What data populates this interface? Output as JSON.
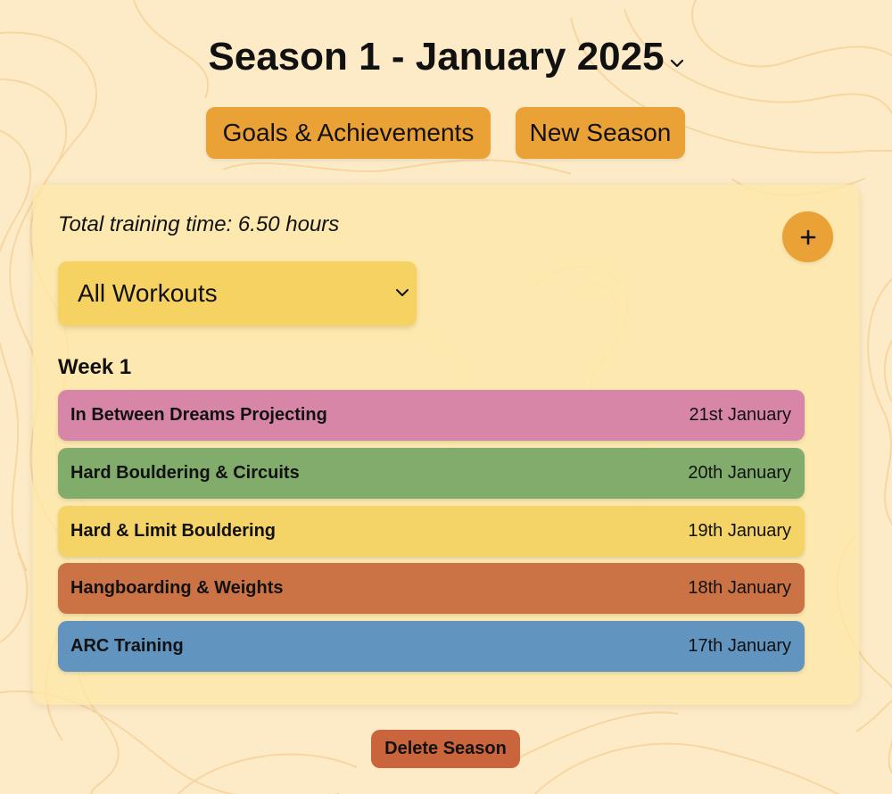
{
  "header": {
    "season_title": "Season 1 - January 2025",
    "season_dropdown_icon": "chevron-down-icon"
  },
  "actions": {
    "goals_label": "Goals & Achievements",
    "new_season_label": "New Season"
  },
  "card": {
    "total_training_time": "Total training time: 6.50 hours",
    "add_icon": "plus-icon",
    "filter": {
      "selected": "All Workouts",
      "icon": "chevron-down-icon"
    },
    "weeks": [
      {
        "label": "Week 1",
        "workouts": [
          {
            "title": "In Between Dreams Projecting",
            "date": "21st January",
            "color": "#d886a8"
          },
          {
            "title": "Hard Bouldering & Circuits",
            "date": "20th January",
            "color": "#82ac6b"
          },
          {
            "title": "Hard & Limit Bouldering",
            "date": "19th January",
            "color": "#f4d466"
          },
          {
            "title": "Hangboarding & Weights",
            "date": "18th January",
            "color": "#cc7346"
          },
          {
            "title": "ARC Training",
            "date": "17th January",
            "color": "#6194bf"
          }
        ]
      }
    ]
  },
  "footer": {
    "delete_label": "Delete Season"
  },
  "colors": {
    "background": "#fdebc8",
    "accent_orange": "#eaa135",
    "delete_red": "#c9643d",
    "filter_yellow": "#f6d262"
  }
}
